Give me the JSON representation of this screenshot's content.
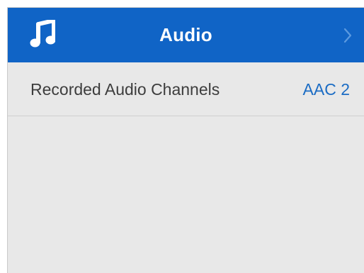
{
  "header": {
    "title": "Audio",
    "icon": "music-note-icon",
    "chevron_icon": "chevron-right-icon"
  },
  "settings": [
    {
      "label": "Recorded Audio Channels",
      "value": "AAC 2"
    }
  ],
  "colors": {
    "header_background": "#1064c6",
    "panel_background": "#e8e8e8",
    "value_text": "#1b6cc4",
    "label_text": "#3d3d3d"
  }
}
